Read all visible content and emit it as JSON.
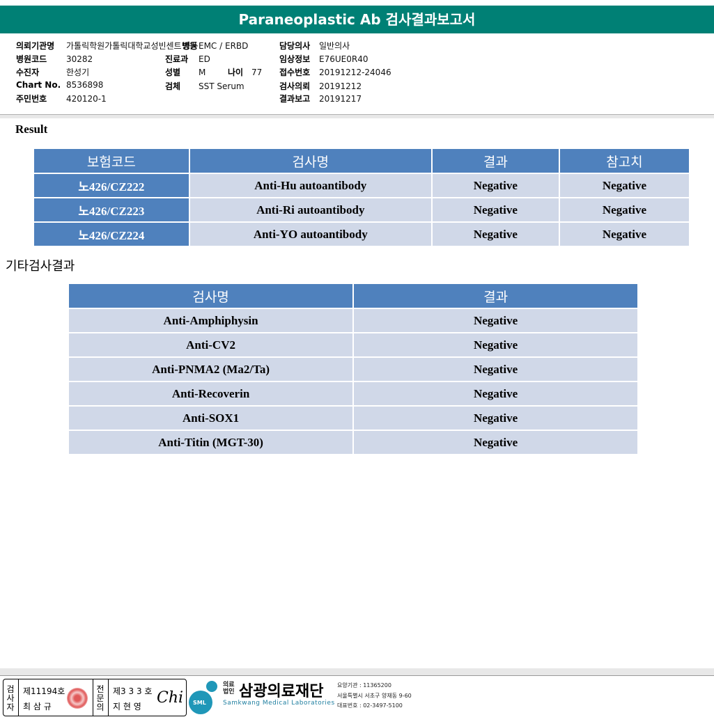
{
  "report": {
    "title": "Paraneoplastic Ab 검사결과보고서"
  },
  "patient": {
    "col1": [
      {
        "label": "의뢰기관명",
        "value": "가톨릭학원가톨릭대학교성빈센트병원"
      },
      {
        "label": "병원코드",
        "value": "30282"
      },
      {
        "label": "수진자",
        "value": "한성기"
      },
      {
        "label": "Chart No.",
        "value": "8536898"
      },
      {
        "label": "주민번호",
        "value": "420120-1"
      }
    ],
    "col2": {
      "ward_label": "병동",
      "ward_value": "EMC / ERBD",
      "dept_label": "진료과",
      "dept_value": "ED",
      "sex_label": "성별",
      "sex_value": "M",
      "age_label": "나이",
      "age_value": "77",
      "specimen_label": "검체",
      "specimen_value": "SST Serum"
    },
    "col3": [
      {
        "label": "담당의사",
        "value": "일반의사"
      },
      {
        "label": "임상정보",
        "value": "E76UE0R40"
      },
      {
        "label": "접수번호",
        "value": "20191212-24046"
      },
      {
        "label": "검사의뢰",
        "value": "20191212"
      },
      {
        "label": "결과보고",
        "value": "20191217"
      }
    ]
  },
  "result": {
    "heading": "Result",
    "headers": [
      "보험코드",
      "검사명",
      "결과",
      "참고치"
    ],
    "rows": [
      [
        "노426/CZ222",
        "Anti-Hu autoantibody",
        "Negative",
        "Negative"
      ],
      [
        "노426/CZ223",
        "Anti-Ri autoantibody",
        "Negative",
        "Negative"
      ],
      [
        "노426/CZ224",
        "Anti-YO autoantibody",
        "Negative",
        "Negative"
      ]
    ]
  },
  "other": {
    "heading": "기타검사결과",
    "headers": [
      "검사명",
      "결과"
    ],
    "rows": [
      [
        "Anti-Amphiphysin",
        "Negative"
      ],
      [
        "Anti-CV2",
        "Negative"
      ],
      [
        "Anti-PNMA2 (Ma2/Ta)",
        "Negative"
      ],
      [
        "Anti-Recoverin",
        "Negative"
      ],
      [
        "Anti-SOX1",
        "Negative"
      ],
      [
        "Anti-Titin (MGT-30)",
        "Negative"
      ]
    ]
  },
  "footer": {
    "tester_label": [
      "검",
      "사",
      "자"
    ],
    "tester_no": "제11194호",
    "tester_name": "최 삼 규",
    "specialist_label": [
      "전",
      "문",
      "의"
    ],
    "specialist_no": "제3 3 3 호",
    "specialist_name": "지 현 영",
    "org_type": [
      "의료",
      "법인"
    ],
    "org_name": "삼광의료재단",
    "org_en": "Samkwang Medical Laboratories",
    "logo_text": "SML",
    "code_line": "요양기관 : 11365200",
    "address": "서울특별시 서초구 양재동 9-60",
    "phone": "대표번호 : 02-3497-5100",
    "signature": "Chi"
  }
}
